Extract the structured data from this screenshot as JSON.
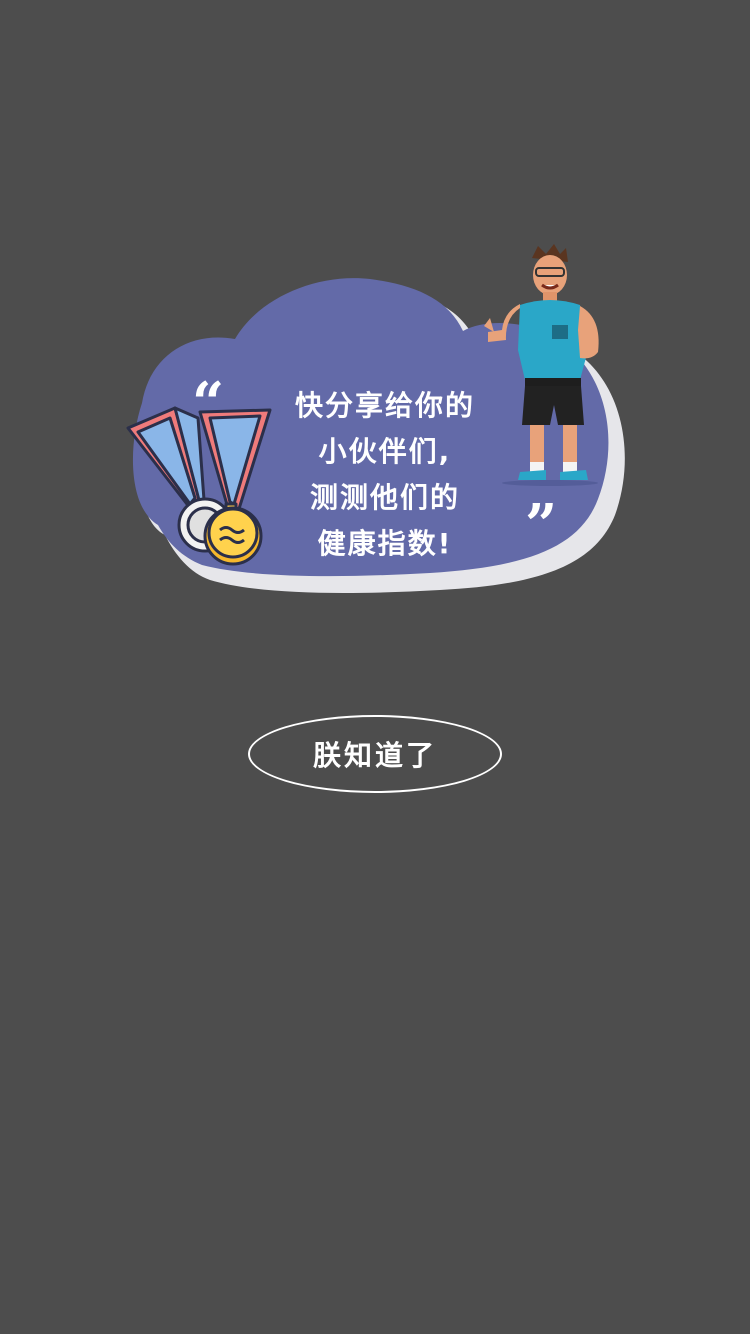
{
  "share_card": {
    "lines": [
      "快分享给你的",
      "小伙伴们,",
      "测测他们的",
      "健康指数!"
    ],
    "quote_open": "“",
    "quote_close": "”",
    "colors": {
      "cloud": "#636aa8",
      "cloud_shadow": "#e6e6ea",
      "overlay": "#4d4d4d"
    },
    "icons": [
      "medal-icon",
      "coach-illustration"
    ]
  },
  "dismiss_button": {
    "label": "朕知道了"
  }
}
